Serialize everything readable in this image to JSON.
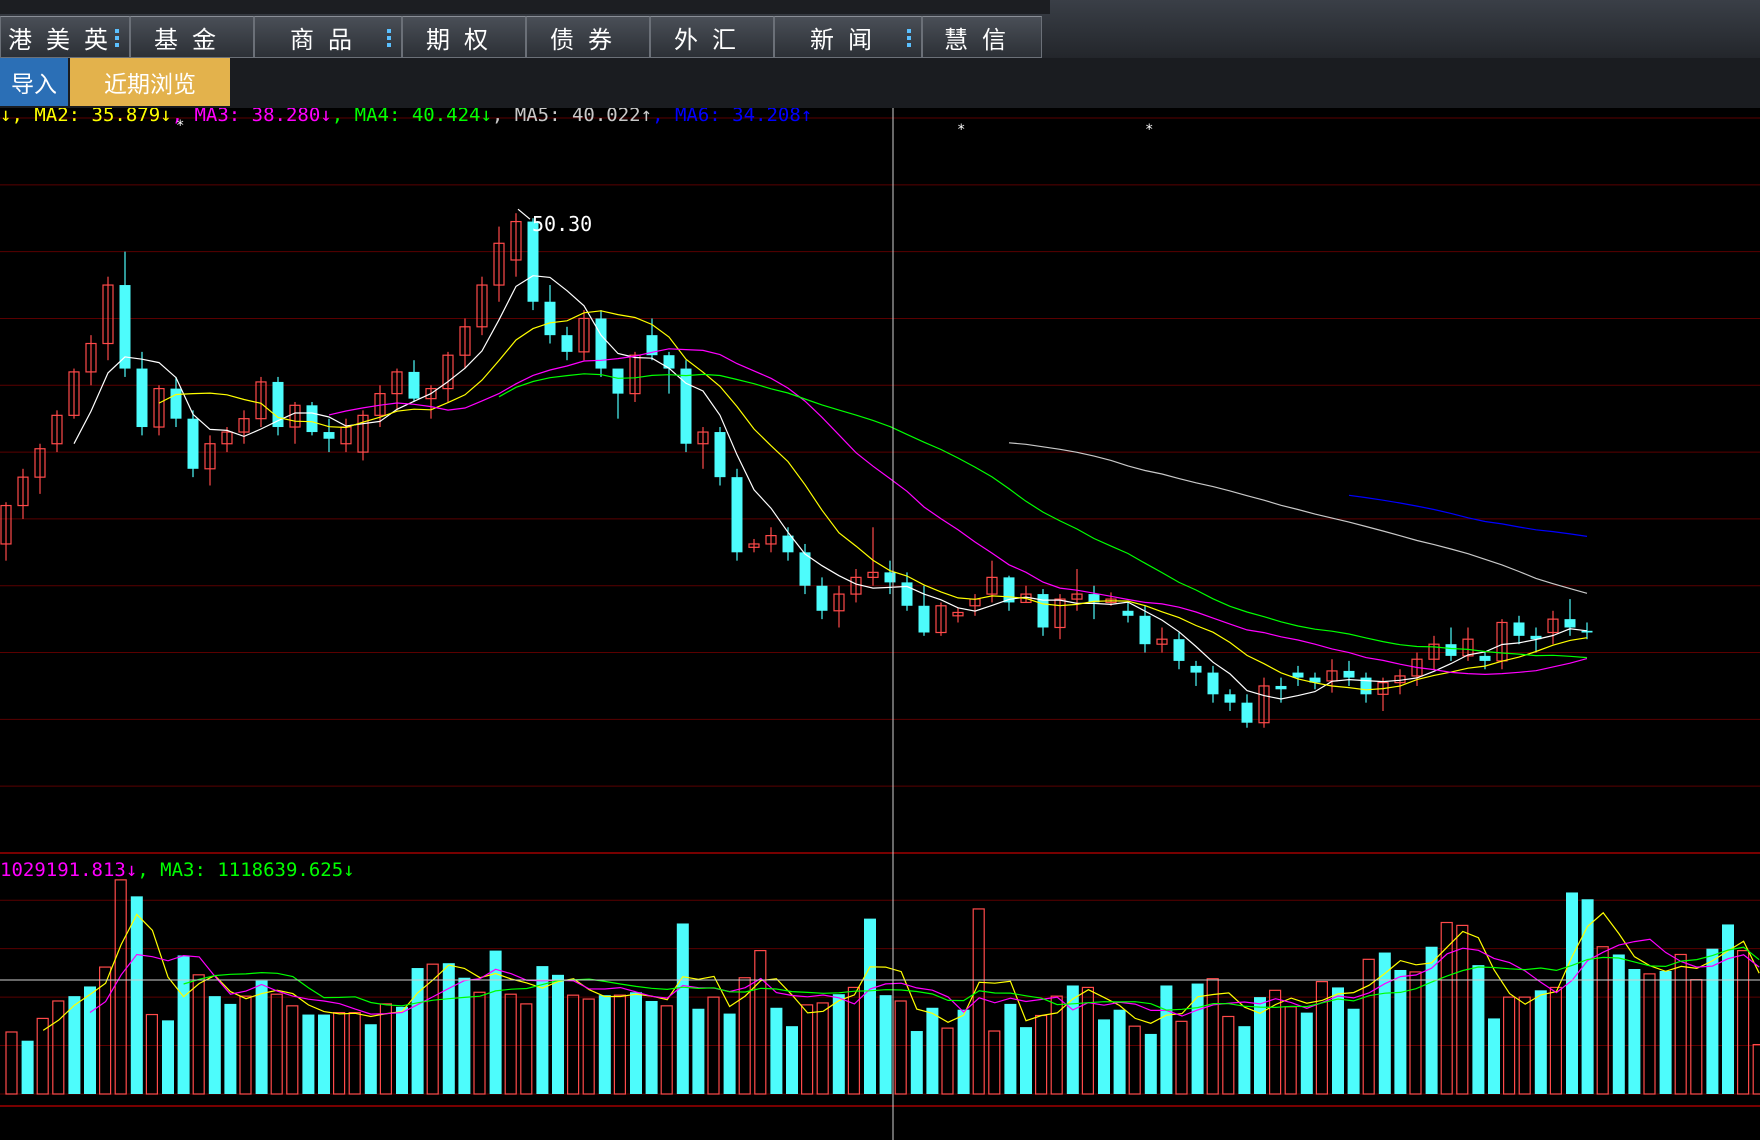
{
  "tabs": [
    {
      "label": "港美英",
      "dots": true,
      "width": 130
    },
    {
      "label": "基金",
      "dots": false,
      "width": 124
    },
    {
      "label": "商品",
      "dots": true,
      "width": 148
    },
    {
      "label": "期权",
      "dots": false,
      "width": 124
    },
    {
      "label": "债券",
      "dots": false,
      "width": 124
    },
    {
      "label": "外汇",
      "dots": false,
      "width": 124
    },
    {
      "label": "新闻",
      "dots": true,
      "width": 148
    },
    {
      "label": "慧信",
      "dots": false,
      "width": 120
    }
  ],
  "subbar": {
    "import_label": "导入",
    "recent_label": "近期浏览"
  },
  "colors": {
    "up": "#ff4a4a",
    "down": "#4dfcfc",
    "grid": "#5a0000",
    "ma1": "#ffffff",
    "ma2": "#ffff00",
    "ma3": "#ff00ff",
    "ma4": "#00ff00",
    "ma5": "#c8c8c8",
    "ma6": "#0000ff"
  },
  "chart_data": {
    "type": "candlestick",
    "price_ylim": [
      12,
      56
    ],
    "volume_ylim": [
      0,
      2250000
    ],
    "high_label": "50.30",
    "ma_legend": [
      {
        "text": "↓, MA2: 35.879↓",
        "color": "#ffff00"
      },
      {
        "text": ", MA3: 38.280↓",
        "color": "#ff00ff"
      },
      {
        "text": ", MA4: 40.424↓",
        "color": "#00ff00"
      },
      {
        "text": ", MA5: 40.022↑",
        "color": "#c8c8c8"
      },
      {
        "text": ", MA6: 34.208↑",
        "color": "#0000ff"
      }
    ],
    "vol_legend": [
      {
        "text": "1029191.813↓",
        "color": "#ff00ff"
      },
      {
        "text": ", MA3: 1118639.625↓",
        "color": "#00ff00"
      }
    ],
    "ohlc": [
      [
        30.5,
        33.0,
        29.5,
        32.8
      ],
      [
        32.8,
        35.0,
        32.0,
        34.5
      ],
      [
        34.5,
        36.5,
        33.5,
        36.2
      ],
      [
        36.5,
        38.5,
        36.0,
        38.2
      ],
      [
        38.2,
        41.0,
        38.0,
        40.8
      ],
      [
        40.8,
        43.0,
        40.0,
        42.5
      ],
      [
        42.5,
        46.5,
        41.5,
        46.0
      ],
      [
        46.0,
        48.0,
        40.5,
        41.0
      ],
      [
        41.0,
        42.0,
        37.0,
        37.5
      ],
      [
        37.5,
        40.0,
        37.0,
        39.8
      ],
      [
        39.8,
        40.5,
        37.5,
        38.0
      ],
      [
        38.0,
        38.5,
        34.5,
        35.0
      ],
      [
        35.0,
        37.0,
        34.0,
        36.5
      ],
      [
        36.5,
        37.5,
        36.0,
        37.2
      ],
      [
        37.2,
        38.5,
        36.5,
        38.0
      ],
      [
        38.0,
        40.5,
        37.5,
        40.2
      ],
      [
        40.2,
        40.5,
        37.0,
        37.5
      ],
      [
        37.5,
        39.0,
        36.5,
        38.8
      ],
      [
        38.8,
        39.0,
        37.0,
        37.2
      ],
      [
        37.2,
        38.0,
        36.0,
        36.8
      ],
      [
        36.5,
        38.0,
        36.0,
        37.5
      ],
      [
        36.0,
        38.5,
        35.5,
        38.2
      ],
      [
        38.2,
        40.0,
        37.5,
        39.5
      ],
      [
        39.5,
        41.0,
        38.5,
        40.8
      ],
      [
        40.8,
        41.5,
        39.0,
        39.2
      ],
      [
        39.2,
        40.0,
        38.0,
        39.8
      ],
      [
        39.8,
        42.0,
        39.0,
        41.8
      ],
      [
        41.8,
        44.0,
        41.0,
        43.5
      ],
      [
        43.5,
        46.5,
        43.0,
        46.0
      ],
      [
        46.0,
        49.5,
        45.0,
        48.5
      ],
      [
        47.5,
        50.3,
        46.5,
        49.8
      ],
      [
        49.8,
        50.0,
        44.5,
        45.0
      ],
      [
        45.0,
        46.0,
        42.5,
        43.0
      ],
      [
        43.0,
        43.5,
        41.5,
        42.0
      ],
      [
        42.0,
        44.5,
        41.5,
        44.0
      ],
      [
        44.0,
        44.5,
        40.5,
        41.0
      ],
      [
        41.0,
        40.5,
        38.0,
        39.5
      ],
      [
        39.5,
        42.0,
        39.0,
        41.8
      ],
      [
        43.0,
        44.0,
        41.5,
        41.8
      ],
      [
        41.8,
        42.0,
        39.5,
        41.0
      ],
      [
        41.0,
        41.5,
        36.0,
        36.5
      ],
      [
        36.5,
        37.5,
        35.0,
        37.2
      ],
      [
        37.2,
        37.5,
        34.0,
        34.5
      ],
      [
        34.5,
        35.0,
        29.5,
        30.0
      ],
      [
        30.3,
        30.8,
        30.0,
        30.5
      ],
      [
        30.5,
        31.5,
        30.0,
        31.0
      ],
      [
        31.0,
        31.5,
        29.5,
        30.0
      ],
      [
        30.0,
        30.5,
        27.5,
        28.0
      ],
      [
        28.0,
        28.5,
        26.0,
        26.5
      ],
      [
        26.5,
        28.0,
        25.5,
        27.5
      ],
      [
        27.5,
        29.0,
        27.0,
        28.5
      ],
      [
        28.5,
        31.5,
        28.0,
        28.8
      ],
      [
        28.8,
        29.5,
        27.5,
        28.2
      ],
      [
        28.2,
        28.8,
        26.5,
        26.8
      ],
      [
        26.8,
        28.0,
        25.0,
        25.2
      ],
      [
        25.2,
        27.0,
        25.0,
        26.8
      ],
      [
        26.2,
        26.7,
        25.8,
        26.4
      ],
      [
        26.8,
        27.5,
        26.2,
        27.2
      ],
      [
        27.5,
        29.5,
        27.0,
        28.5
      ],
      [
        28.5,
        28.6,
        26.5,
        27.0
      ],
      [
        27.0,
        28.0,
        27.0,
        27.5
      ],
      [
        27.5,
        27.8,
        25.0,
        25.5
      ],
      [
        25.5,
        27.5,
        24.8,
        27.2
      ],
      [
        27.2,
        29.0,
        26.5,
        27.5
      ],
      [
        27.5,
        28.0,
        26.0,
        27.0
      ],
      [
        27.0,
        27.6,
        26.8,
        27.2
      ],
      [
        26.5,
        27.0,
        25.8,
        26.2
      ],
      [
        26.2,
        26.8,
        24.0,
        24.5
      ],
      [
        24.5,
        25.5,
        24.0,
        24.8
      ],
      [
        24.8,
        25.2,
        23.0,
        23.5
      ],
      [
        23.2,
        23.5,
        22.0,
        22.8
      ],
      [
        22.8,
        23.2,
        21.0,
        21.5
      ],
      [
        21.5,
        21.8,
        20.5,
        21.0
      ],
      [
        21.0,
        21.5,
        19.5,
        19.8
      ],
      [
        19.8,
        22.5,
        19.5,
        22.0
      ],
      [
        22.0,
        22.5,
        21.0,
        21.8
      ],
      [
        22.8,
        23.2,
        22.0,
        22.5
      ],
      [
        22.5,
        22.8,
        21.8,
        22.2
      ],
      [
        22.3,
        23.6,
        21.6,
        22.9
      ],
      [
        22.9,
        23.5,
        22.0,
        22.5
      ],
      [
        22.5,
        22.8,
        21.0,
        21.5
      ],
      [
        21.5,
        22.5,
        20.5,
        22.2
      ],
      [
        22.2,
        23.0,
        21.5,
        22.6
      ],
      [
        22.6,
        24.0,
        22.0,
        23.6
      ],
      [
        23.6,
        25.0,
        23.0,
        24.5
      ],
      [
        24.5,
        25.5,
        23.5,
        23.8
      ],
      [
        23.8,
        25.5,
        23.5,
        24.8
      ],
      [
        23.8,
        24.0,
        23.0,
        23.5
      ],
      [
        23.5,
        26.0,
        23.0,
        25.8
      ],
      [
        25.8,
        26.2,
        24.5,
        25.0
      ],
      [
        25.0,
        25.5,
        24.0,
        24.8
      ],
      [
        25.2,
        26.5,
        24.5,
        26.0
      ],
      [
        26.0,
        27.2,
        25.0,
        25.5
      ],
      [
        25.3,
        25.8,
        24.8,
        25.2
      ]
    ],
    "volume": [
      640000,
      550000,
      780000,
      960000,
      1010000,
      1110000,
      1310000,
      2210000,
      2040000,
      820000,
      760000,
      1430000,
      1230000,
      1010000,
      930000,
      1010000,
      1170000,
      1030000,
      910000,
      820000,
      820000,
      840000,
      840000,
      720000,
      930000,
      900000,
      1300000,
      1340000,
      1350000,
      1200000,
      1050000,
      1480000,
      1030000,
      930000,
      1320000,
      1230000,
      1020000,
      980000,
      1020000,
      1020000,
      1050000,
      960000,
      910000,
      1760000,
      880000,
      1000000,
      830000,
      1200000,
      1480000,
      890000,
      700000,
      920000,
      940000,
      1030000,
      1100000,
      1810000,
      1020000,
      960000,
      650000,
      890000,
      680000,
      870000,
      1910000,
      650000,
      930000,
      690000,
      810000,
      1010000,
      1120000,
      1100000,
      770000,
      870000,
      700000,
      620000,
      1120000,
      750000,
      1140000,
      1190000,
      800000,
      700000,
      1000000,
      1070000,
      900000,
      840000,
      1160000,
      1100000,
      880000,
      1390000,
      1460000,
      1280000,
      1260000,
      1520000,
      1770000,
      1740000,
      1330000,
      780000,
      1000000,
      1000000,
      1070000,
      1100000,
      2080000,
      2010000,
      1520000,
      1440000,
      1290000,
      1240000,
      1270000,
      1440000,
      1180000,
      1500000,
      1750000,
      1480000,
      510000
    ]
  }
}
